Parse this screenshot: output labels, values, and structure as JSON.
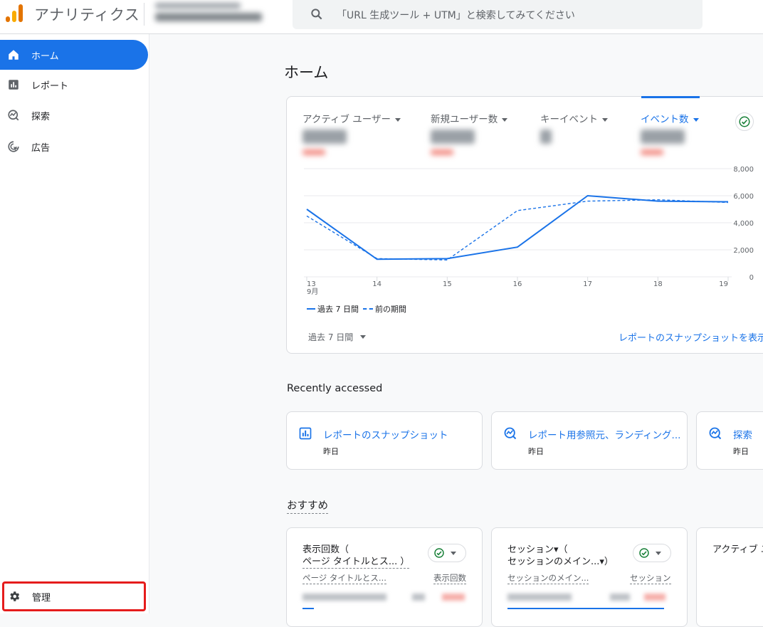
{
  "header": {
    "app_title": "アナリティクス",
    "search_placeholder": "「URL 生成ツール + UTM」と検索してみてください"
  },
  "sidebar": {
    "items": [
      {
        "label": "ホーム",
        "icon": "home-icon",
        "active": true
      },
      {
        "label": "レポート",
        "icon": "reports-icon",
        "active": false
      },
      {
        "label": "探索",
        "icon": "explore-icon",
        "active": false
      },
      {
        "label": "広告",
        "icon": "advertising-icon",
        "active": false
      }
    ],
    "admin_label": "管理"
  },
  "main": {
    "page_title": "ホーム",
    "metrics": [
      {
        "label": "アクティブ ユーザー"
      },
      {
        "label": "新規ユーザー数"
      },
      {
        "label": "キーイベント"
      },
      {
        "label": "イベント数"
      }
    ],
    "legend_current": "過去 7 日間",
    "legend_previous": "前の期間",
    "date_range": "過去 7 日間",
    "snapshot_link": "レポートのスナップショットを表示"
  },
  "chart_data": {
    "type": "line",
    "x": [
      "13",
      "14",
      "15",
      "16",
      "17",
      "18",
      "19"
    ],
    "x_sublabel_first": "9月",
    "y_ticks": [
      "8,000",
      "6,000",
      "4,000",
      "2,000",
      "0"
    ],
    "ylim": [
      0,
      8000
    ],
    "series": [
      {
        "name": "過去 7 日間",
        "values": [
          5000,
          1300,
          1350,
          2200,
          6000,
          5600,
          5550
        ]
      },
      {
        "name": "前の期間",
        "values": [
          4500,
          1350,
          1250,
          4900,
          5600,
          5700,
          5500
        ]
      }
    ],
    "colors": {
      "line": "#1a73e8"
    }
  },
  "recent": {
    "title": "Recently accessed",
    "items": [
      {
        "title": "レポートのスナップショット",
        "sub": "昨日",
        "icon": "bar-chart-icon"
      },
      {
        "title": "レポート用参照元、ランディング...",
        "sub": "昨日",
        "icon": "explore-icon"
      },
      {
        "title": "探索",
        "sub": "昨日",
        "icon": "explore-icon"
      }
    ]
  },
  "recommended": {
    "title": "おすすめ",
    "cards": [
      {
        "line1": "表示回数（",
        "line2": "ページ タイトルとス... ）",
        "col1": "ページ タイトルとス...",
        "col2": "表示回数"
      },
      {
        "line1": "セッション▾（",
        "line2": "セッションのメイン...▾）",
        "col1": "セッションのメイン...",
        "col2": "セッション"
      },
      {
        "line1": "アクティブ ユ",
        "line2": "",
        "col1": "",
        "col2": ""
      }
    ]
  }
}
